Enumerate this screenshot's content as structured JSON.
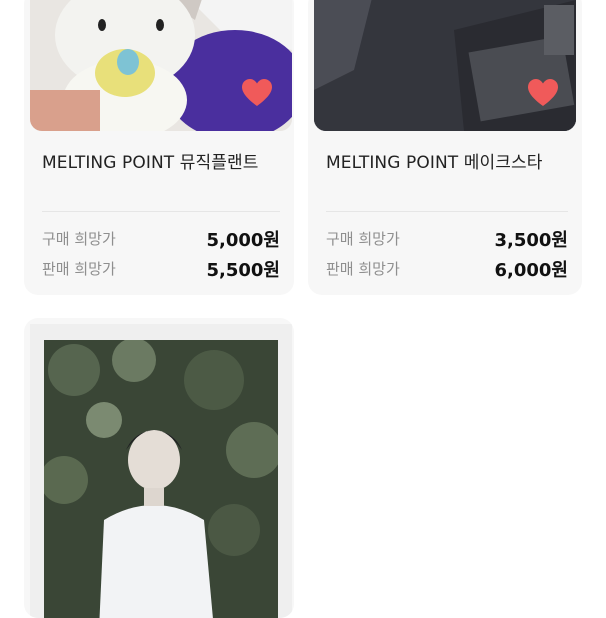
{
  "listings": [
    {
      "title": "MELTING POINT 뮤직플랜트",
      "buy_label": "구매 희망가",
      "buy_price": "5,000원",
      "sell_label": "판매 희망가",
      "sell_price": "5,500원",
      "liked": true
    },
    {
      "title": "MELTING POINT 메이크스타",
      "buy_label": "구매 희망가",
      "buy_price": "3,500원",
      "sell_label": "판매 희망가",
      "sell_price": "6,000원",
      "liked": true
    },
    {
      "title": "",
      "liked": false
    }
  ],
  "colors": {
    "heart": "#f05a5a",
    "card_bg": "#f7f7f7",
    "label": "#8f8f8f"
  }
}
